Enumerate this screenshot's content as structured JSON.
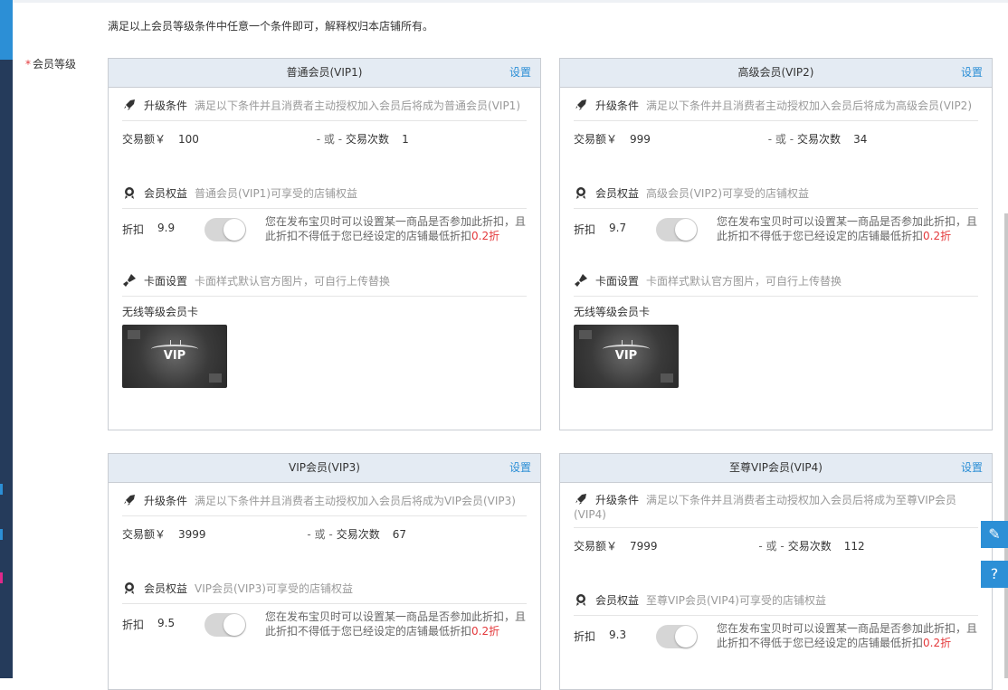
{
  "description": "满足以上会员等级条件中任意一个条件即可，解释权归本店铺所有。",
  "field_label": "会员等级",
  "required_mark": "*",
  "labels": {
    "set": "设置",
    "upgrade": "升级条件",
    "benefit": "会员权益",
    "cardset": "卡面设置",
    "amount": "交易额￥",
    "or": "- 或 -",
    "count": "交易次数",
    "discount": "折扣",
    "note_a": "您在发布宝贝时可以设置某一商品是否参加此折扣，且此折扣不得低于您已经设定的店铺最低折扣",
    "note_b": "0.2折",
    "cardset_desc": "卡面样式默认官方图片，可自行上传替换",
    "wireless_card": "无线等级会员卡",
    "vip_text": "VIP"
  },
  "cards": [
    {
      "title": "普通会员(VIP1)",
      "upgrade_desc": "满足以下条件并且消费者主动授权加入会员后将成为普通会员(VIP1)",
      "amount": "100",
      "count": "1",
      "benefit_desc": "普通会员(VIP1)可享受的店铺权益",
      "discount": "9.9"
    },
    {
      "title": "高级会员(VIP2)",
      "upgrade_desc": "满足以下条件并且消费者主动授权加入会员后将成为高级会员(VIP2)",
      "amount": "999",
      "count": "34",
      "benefit_desc": "高级会员(VIP2)可享受的店铺权益",
      "discount": "9.7"
    },
    {
      "title": "VIP会员(VIP3)",
      "upgrade_desc": "满足以下条件并且消费者主动授权加入会员后将成为VIP会员(VIP3)",
      "amount": "3999",
      "count": "67",
      "benefit_desc": "VIP会员(VIP3)可享受的店铺权益",
      "discount": "9.5"
    },
    {
      "title": "至尊VIP会员(VIP4)",
      "upgrade_desc": "满足以下条件并且消费者主动授权加入会员后将成为至尊VIP会员(VIP4)",
      "amount": "7999",
      "count": "112",
      "benefit_desc": "至尊VIP会员(VIP4)可享受的店铺权益",
      "discount": "9.3"
    }
  ],
  "icons": {
    "upgrade": "rocket-icon",
    "benefit": "medal-icon",
    "cardset": "brush-icon",
    "edit": "pencil-icon",
    "help": "question-icon"
  },
  "colors": {
    "accent": "#2c8fd6",
    "header_bg": "#e4ebf3",
    "required": "#e4393c",
    "sidebar": "#253b5b"
  }
}
